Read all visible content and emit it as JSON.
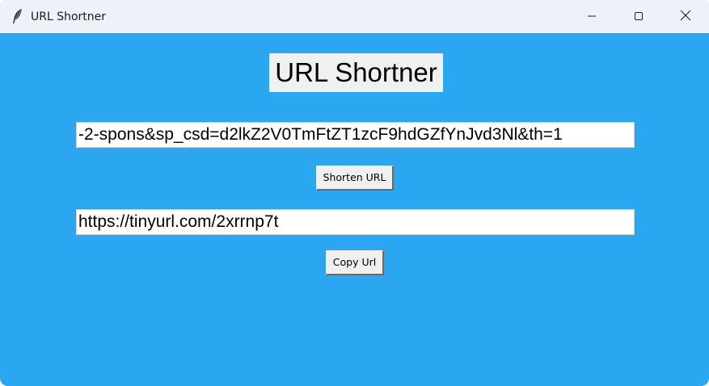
{
  "window": {
    "title": "URL Shortner",
    "icon": "feather-icon"
  },
  "controls": {
    "minimize": "minimize-icon",
    "maximize": "maximize-icon",
    "close": "close-icon"
  },
  "main": {
    "heading": "URL Shortner",
    "long_url_value": "-2-spons&sp_csd=d2lkZ2V0TmFtZT1zcF9hdGZfYnJvd3Nl&th=1",
    "shorten_button_label": "Shorten URL",
    "short_url_value": "https://tinyurl.com/2xrrnp7t",
    "copy_button_label": "Copy Url"
  },
  "colors": {
    "background": "#2ba7f1",
    "titlebar": "#eef1f8"
  }
}
